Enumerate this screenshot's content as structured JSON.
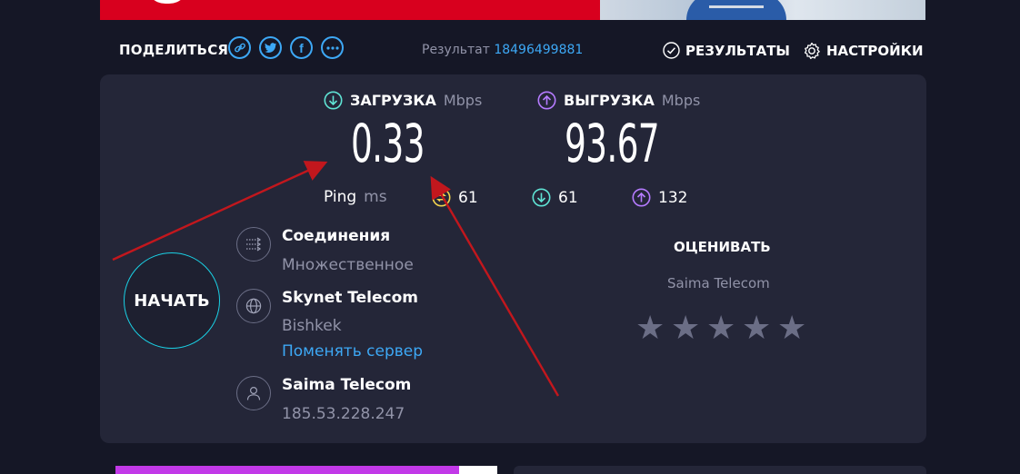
{
  "share": {
    "label": "ПОДЕЛИТЬСЯ"
  },
  "result": {
    "label": "Результат",
    "id": "18496499881"
  },
  "nav": {
    "results": "РЕЗУЛЬТАТЫ",
    "settings": "НАСТРОЙКИ"
  },
  "download": {
    "label": "ЗАГРУЗКА",
    "unit": "Mbps",
    "value": "0.33"
  },
  "upload": {
    "label": "ВЫГРУЗКА",
    "unit": "Mbps",
    "value": "93.67"
  },
  "ping": {
    "label": "Ping",
    "unit": "ms",
    "idle": "61",
    "down": "61",
    "up": "132"
  },
  "start_button": "НАЧАТЬ",
  "connections": {
    "title": "Соединения",
    "value": "Множественное"
  },
  "server": {
    "name": "Skynet Telecom",
    "city": "Bishkek",
    "change_link": "Поменять сервер"
  },
  "provider": {
    "name": "Saima Telecom",
    "ip": "185.53.228.247"
  },
  "rating": {
    "title": "ОЦЕНИВАТЬ",
    "isp": "Saima Telecom",
    "stars": 5
  },
  "colors": {
    "accent_blue": "#3da8f5",
    "download_teal": "#5fe3d4",
    "upload_purple": "#b57bff",
    "ping_yellow": "#f2d34c",
    "start_ring": "#1ad1e5"
  }
}
